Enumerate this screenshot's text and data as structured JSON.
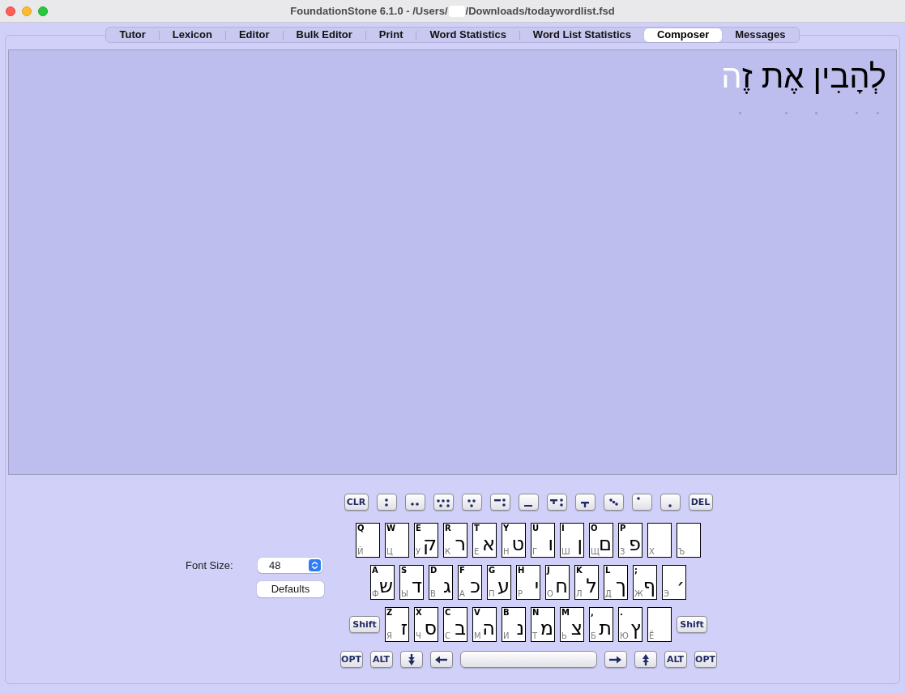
{
  "window": {
    "title_parts": [
      "FoundationStone 6.1.0 - /Users/",
      "/Downloads/todaywordlist.fsd"
    ],
    "redacted": true
  },
  "tabs": [
    {
      "label": "Tutor",
      "selected": false
    },
    {
      "label": "Lexicon",
      "selected": false
    },
    {
      "label": "Editor",
      "selected": false
    },
    {
      "label": "Bulk Editor",
      "selected": false
    },
    {
      "label": "Print",
      "selected": false
    },
    {
      "label": "Word Statistics",
      "selected": false
    },
    {
      "label": "Word List Statistics",
      "selected": false
    },
    {
      "label": "Composer",
      "selected": true
    },
    {
      "label": "Messages",
      "selected": false
    }
  ],
  "composer": {
    "segments": [
      {
        "text": "לְהָבִין אֶת זֶ",
        "highlighted": false
      },
      {
        "text": "ה",
        "highlighted": true
      }
    ]
  },
  "font_size": {
    "label": "Font Size:",
    "value": "48"
  },
  "defaults_button": "Defaults",
  "keyboard": {
    "point_row": [
      {
        "kind": "clear",
        "label": "CLR"
      },
      {
        "kind": "shva"
      },
      {
        "kind": "tsere"
      },
      {
        "kind": "hatafsegol"
      },
      {
        "kind": "segol"
      },
      {
        "kind": "hatafpatah"
      },
      {
        "kind": "patah"
      },
      {
        "kind": "hatafqamats"
      },
      {
        "kind": "qamats"
      },
      {
        "kind": "qubuts"
      },
      {
        "kind": "holam"
      },
      {
        "kind": "dagesh"
      },
      {
        "kind": "delete",
        "label": "DEL"
      }
    ],
    "rows": [
      [
        {
          "kind": "letter",
          "latin": "Q",
          "cyrillic": "Й"
        },
        {
          "kind": "letter",
          "latin": "W",
          "cyrillic": "Ц"
        },
        {
          "kind": "letter",
          "latin": "E",
          "hebrew": "ק",
          "cyrillic": "У"
        },
        {
          "kind": "letter",
          "latin": "R",
          "hebrew": "ר",
          "cyrillic": "К"
        },
        {
          "kind": "letter",
          "latin": "T",
          "hebrew": "א",
          "cyrillic": "Е"
        },
        {
          "kind": "letter",
          "latin": "Y",
          "hebrew": "ט",
          "cyrillic": "Н"
        },
        {
          "kind": "letter",
          "latin": "U",
          "hebrew": "ו",
          "cyrillic": "Г"
        },
        {
          "kind": "letter",
          "latin": "I",
          "hebrew": "ן",
          "cyrillic": "Ш"
        },
        {
          "kind": "letter",
          "latin": "O",
          "hebrew": "ם",
          "cyrillic": "Щ"
        },
        {
          "kind": "letter",
          "latin": "P",
          "hebrew": "פ",
          "cyrillic": "З"
        },
        {
          "kind": "letter",
          "cyrillic": "Х"
        },
        {
          "kind": "letter",
          "cyrillic": "Ъ"
        }
      ],
      [
        {
          "kind": "letter",
          "latin": "A",
          "hebrew": "ש",
          "cyrillic": "Ф"
        },
        {
          "kind": "letter",
          "latin": "S",
          "hebrew": "ד",
          "cyrillic": "Ы"
        },
        {
          "kind": "letter",
          "latin": "D",
          "hebrew": "ג",
          "cyrillic": "В"
        },
        {
          "kind": "letter",
          "latin": "F",
          "hebrew": "כ",
          "cyrillic": "А"
        },
        {
          "kind": "letter",
          "latin": "G",
          "hebrew": "ע",
          "cyrillic": "П"
        },
        {
          "kind": "letter",
          "latin": "H",
          "hebrew": "י",
          "cyrillic": "Р"
        },
        {
          "kind": "letter",
          "latin": "J",
          "hebrew": "ח",
          "cyrillic": "О"
        },
        {
          "kind": "letter",
          "latin": "K",
          "hebrew": "ל",
          "cyrillic": "Л"
        },
        {
          "kind": "letter",
          "latin": "L",
          "hebrew": "ך",
          "cyrillic": "Д"
        },
        {
          "kind": "letter",
          "latin": ";",
          "hebrew": "ף",
          "cyrillic": "Ж"
        },
        {
          "kind": "letter",
          "hebrew": "׳",
          "cyrillic": "Э"
        }
      ],
      [
        {
          "kind": "shift",
          "label": "Shift"
        },
        {
          "kind": "letter",
          "latin": "Z",
          "hebrew": "ז",
          "cyrillic": "Я"
        },
        {
          "kind": "letter",
          "latin": "X",
          "hebrew": "ס",
          "cyrillic": "Ч"
        },
        {
          "kind": "letter",
          "latin": "C",
          "hebrew": "ב",
          "cyrillic": "С"
        },
        {
          "kind": "letter",
          "latin": "V",
          "hebrew": "ה",
          "cyrillic": "М"
        },
        {
          "kind": "letter",
          "latin": "B",
          "hebrew": "נ",
          "cyrillic": "И"
        },
        {
          "kind": "letter",
          "latin": "N",
          "hebrew": "מ",
          "cyrillic": "Т"
        },
        {
          "kind": "letter",
          "latin": "M",
          "hebrew": "צ",
          "cyrillic": "Ь"
        },
        {
          "kind": "letter",
          "latin": ",",
          "hebrew": "ת",
          "cyrillic": "Б"
        },
        {
          "kind": "letter",
          "latin": ".",
          "hebrew": "ץ",
          "cyrillic": "Ю"
        },
        {
          "kind": "letter",
          "cyrillic": "Ё"
        },
        {
          "kind": "shift",
          "label": "Shift"
        }
      ]
    ],
    "bottom_row": [
      {
        "kind": "option",
        "label": "OPT"
      },
      {
        "kind": "alt",
        "label": "ALT"
      },
      {
        "kind": "down"
      },
      {
        "kind": "left"
      },
      {
        "kind": "space"
      },
      {
        "kind": "right"
      },
      {
        "kind": "up"
      },
      {
        "kind": "alt",
        "label": "ALT"
      },
      {
        "kind": "option",
        "label": "OPT"
      }
    ]
  }
}
